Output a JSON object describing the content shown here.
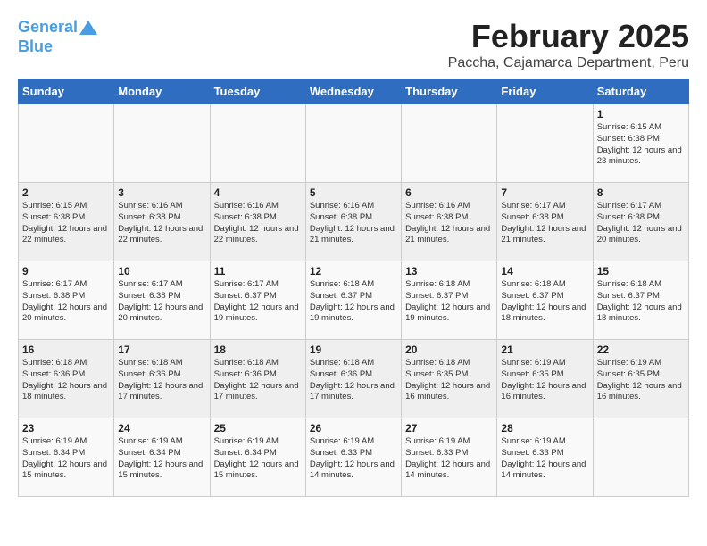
{
  "logo": {
    "line1": "General",
    "line2": "Blue"
  },
  "header": {
    "month_year": "February 2025",
    "location": "Paccha, Cajamarca Department, Peru"
  },
  "weekdays": [
    "Sunday",
    "Monday",
    "Tuesday",
    "Wednesday",
    "Thursday",
    "Friday",
    "Saturday"
  ],
  "weeks": [
    [
      {
        "day": "",
        "info": ""
      },
      {
        "day": "",
        "info": ""
      },
      {
        "day": "",
        "info": ""
      },
      {
        "day": "",
        "info": ""
      },
      {
        "day": "",
        "info": ""
      },
      {
        "day": "",
        "info": ""
      },
      {
        "day": "1",
        "info": "Sunrise: 6:15 AM\nSunset: 6:38 PM\nDaylight: 12 hours\nand 23 minutes."
      }
    ],
    [
      {
        "day": "2",
        "info": "Sunrise: 6:15 AM\nSunset: 6:38 PM\nDaylight: 12 hours\nand 22 minutes."
      },
      {
        "day": "3",
        "info": "Sunrise: 6:16 AM\nSunset: 6:38 PM\nDaylight: 12 hours\nand 22 minutes."
      },
      {
        "day": "4",
        "info": "Sunrise: 6:16 AM\nSunset: 6:38 PM\nDaylight: 12 hours\nand 22 minutes."
      },
      {
        "day": "5",
        "info": "Sunrise: 6:16 AM\nSunset: 6:38 PM\nDaylight: 12 hours\nand 21 minutes."
      },
      {
        "day": "6",
        "info": "Sunrise: 6:16 AM\nSunset: 6:38 PM\nDaylight: 12 hours\nand 21 minutes."
      },
      {
        "day": "7",
        "info": "Sunrise: 6:17 AM\nSunset: 6:38 PM\nDaylight: 12 hours\nand 21 minutes."
      },
      {
        "day": "8",
        "info": "Sunrise: 6:17 AM\nSunset: 6:38 PM\nDaylight: 12 hours\nand 20 minutes."
      }
    ],
    [
      {
        "day": "9",
        "info": "Sunrise: 6:17 AM\nSunset: 6:38 PM\nDaylight: 12 hours\nand 20 minutes."
      },
      {
        "day": "10",
        "info": "Sunrise: 6:17 AM\nSunset: 6:38 PM\nDaylight: 12 hours\nand 20 minutes."
      },
      {
        "day": "11",
        "info": "Sunrise: 6:17 AM\nSunset: 6:37 PM\nDaylight: 12 hours\nand 19 minutes."
      },
      {
        "day": "12",
        "info": "Sunrise: 6:18 AM\nSunset: 6:37 PM\nDaylight: 12 hours\nand 19 minutes."
      },
      {
        "day": "13",
        "info": "Sunrise: 6:18 AM\nSunset: 6:37 PM\nDaylight: 12 hours\nand 19 minutes."
      },
      {
        "day": "14",
        "info": "Sunrise: 6:18 AM\nSunset: 6:37 PM\nDaylight: 12 hours\nand 18 minutes."
      },
      {
        "day": "15",
        "info": "Sunrise: 6:18 AM\nSunset: 6:37 PM\nDaylight: 12 hours\nand 18 minutes."
      }
    ],
    [
      {
        "day": "16",
        "info": "Sunrise: 6:18 AM\nSunset: 6:36 PM\nDaylight: 12 hours\nand 18 minutes."
      },
      {
        "day": "17",
        "info": "Sunrise: 6:18 AM\nSunset: 6:36 PM\nDaylight: 12 hours\nand 17 minutes."
      },
      {
        "day": "18",
        "info": "Sunrise: 6:18 AM\nSunset: 6:36 PM\nDaylight: 12 hours\nand 17 minutes."
      },
      {
        "day": "19",
        "info": "Sunrise: 6:18 AM\nSunset: 6:36 PM\nDaylight: 12 hours\nand 17 minutes."
      },
      {
        "day": "20",
        "info": "Sunrise: 6:18 AM\nSunset: 6:35 PM\nDaylight: 12 hours\nand 16 minutes."
      },
      {
        "day": "21",
        "info": "Sunrise: 6:19 AM\nSunset: 6:35 PM\nDaylight: 12 hours\nand 16 minutes."
      },
      {
        "day": "22",
        "info": "Sunrise: 6:19 AM\nSunset: 6:35 PM\nDaylight: 12 hours\nand 16 minutes."
      }
    ],
    [
      {
        "day": "23",
        "info": "Sunrise: 6:19 AM\nSunset: 6:34 PM\nDaylight: 12 hours\nand 15 minutes."
      },
      {
        "day": "24",
        "info": "Sunrise: 6:19 AM\nSunset: 6:34 PM\nDaylight: 12 hours\nand 15 minutes."
      },
      {
        "day": "25",
        "info": "Sunrise: 6:19 AM\nSunset: 6:34 PM\nDaylight: 12 hours\nand 15 minutes."
      },
      {
        "day": "26",
        "info": "Sunrise: 6:19 AM\nSunset: 6:33 PM\nDaylight: 12 hours\nand 14 minutes."
      },
      {
        "day": "27",
        "info": "Sunrise: 6:19 AM\nSunset: 6:33 PM\nDaylight: 12 hours\nand 14 minutes."
      },
      {
        "day": "28",
        "info": "Sunrise: 6:19 AM\nSunset: 6:33 PM\nDaylight: 12 hours\nand 14 minutes."
      },
      {
        "day": "",
        "info": ""
      }
    ]
  ]
}
